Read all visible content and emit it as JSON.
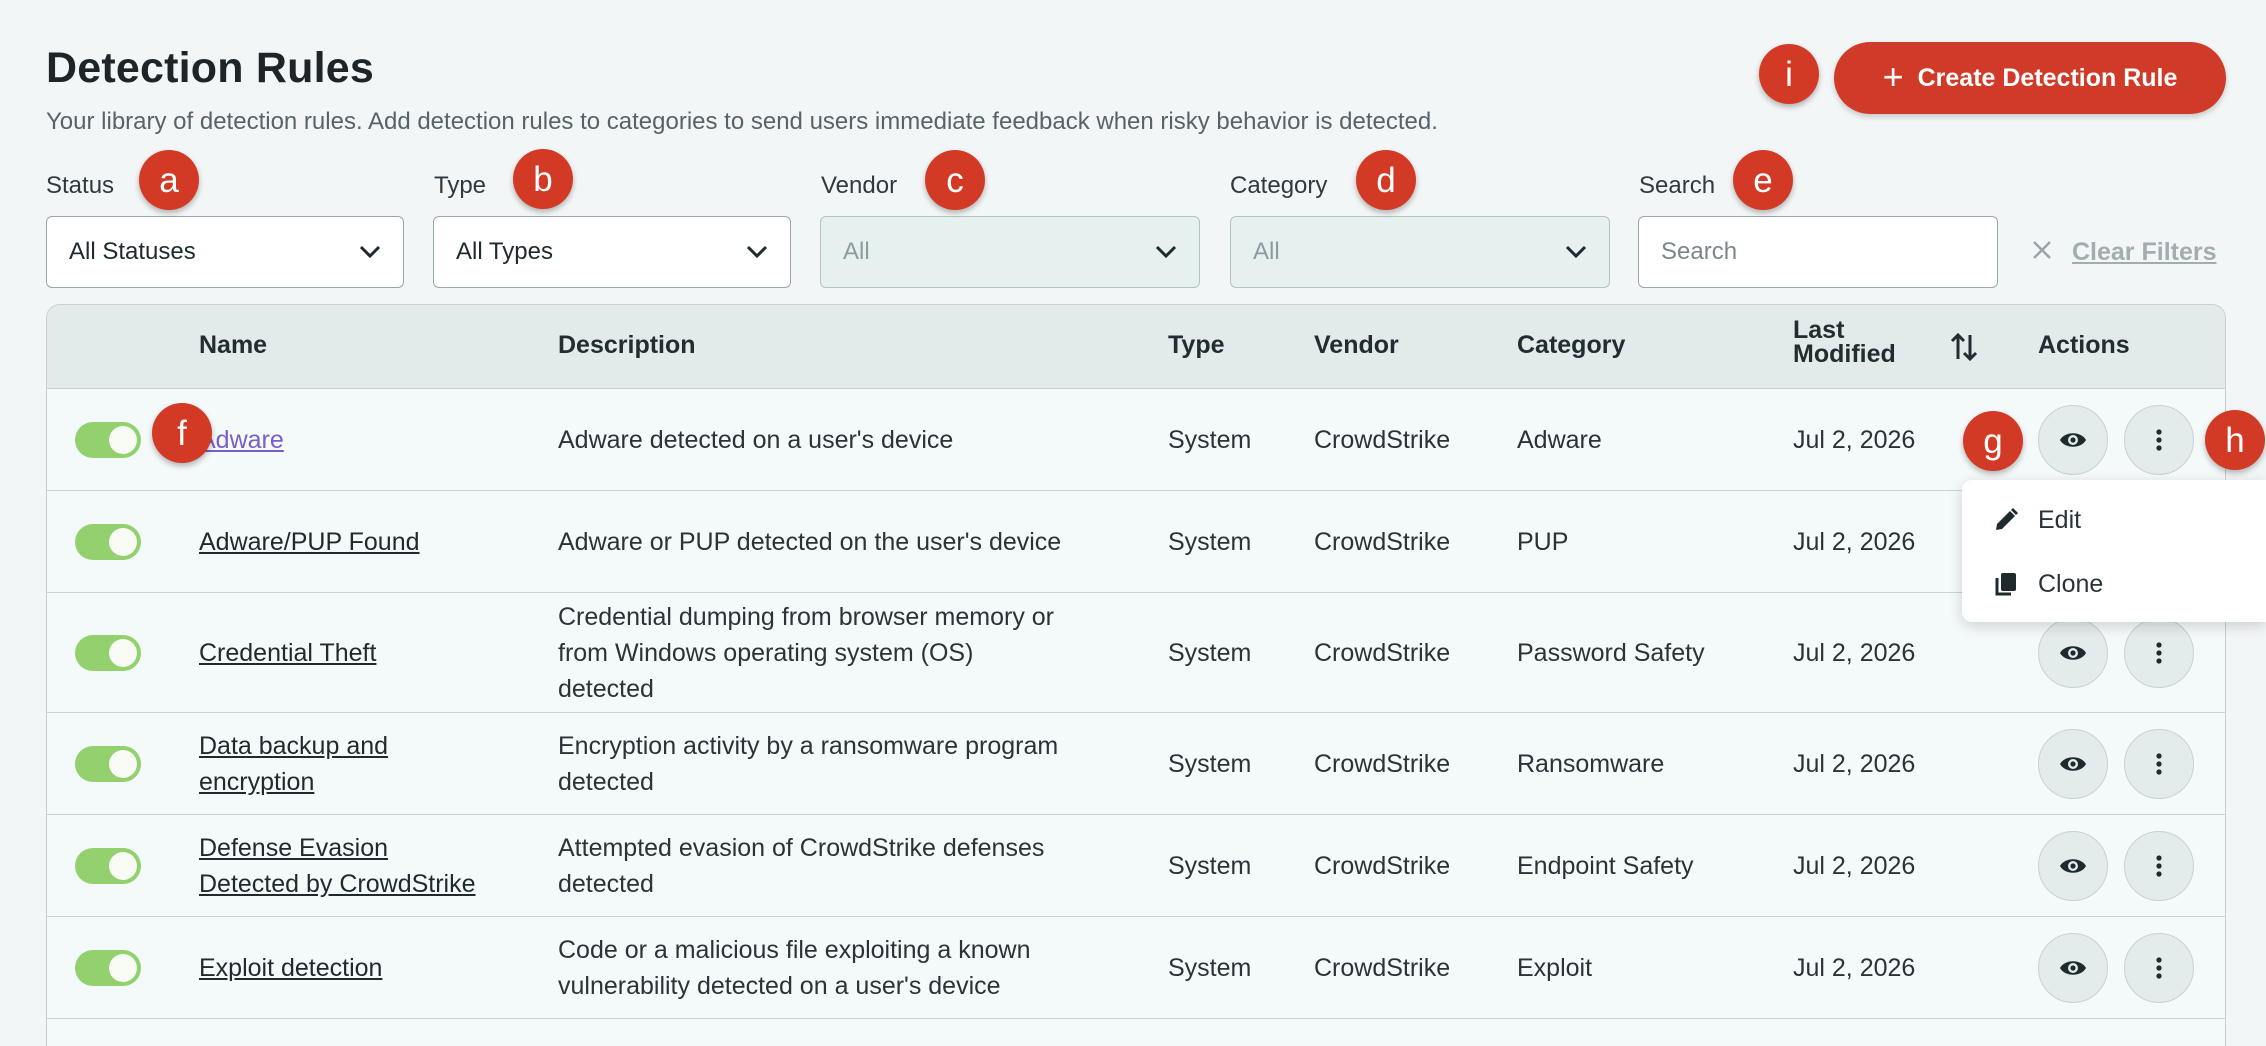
{
  "header": {
    "title": "Detection Rules",
    "subtitle": "Your library of detection rules. Add detection rules to categories to send users immediate feedback when risky behavior is detected.",
    "create_label": "Create Detection Rule"
  },
  "filters": {
    "status": {
      "label": "Status",
      "value": "All Statuses"
    },
    "type": {
      "label": "Type",
      "value": "All Types"
    },
    "vendor": {
      "label": "Vendor",
      "value": "All"
    },
    "category": {
      "label": "Category",
      "value": "All"
    },
    "search": {
      "label": "Search",
      "placeholder": "Search"
    },
    "clear_label": "Clear Filters"
  },
  "badges": [
    "a",
    "b",
    "c",
    "d",
    "e",
    "f",
    "g",
    "h",
    "i"
  ],
  "table": {
    "columns": {
      "name": "Name",
      "description": "Description",
      "type": "Type",
      "vendor": "Vendor",
      "category": "Category",
      "last_modified_1": "Last",
      "last_modified_2": "Modified",
      "actions": "Actions"
    },
    "rows": [
      {
        "name_1": "Adware",
        "name_2": "",
        "desc_1": "Adware detected on a user's device",
        "desc_2": "",
        "desc_3": "",
        "type": "System",
        "vendor": "CrowdStrike",
        "category": "Adware",
        "modified": "Jul 2, 2026",
        "enabled": true
      },
      {
        "name_1": "Adware/PUP Found",
        "name_2": "",
        "desc_1": "Adware or PUP detected on the user's device",
        "desc_2": "",
        "desc_3": "",
        "type": "System",
        "vendor": "CrowdStrike",
        "category": "PUP",
        "modified": "Jul 2, 2026",
        "enabled": true
      },
      {
        "name_1": "Credential Theft",
        "name_2": "",
        "desc_1": "Credential dumping from browser memory or",
        "desc_2": "from Windows operating system (OS)",
        "desc_3": "detected",
        "type": "System",
        "vendor": "CrowdStrike",
        "category": "Password Safety",
        "modified": "Jul 2, 2026",
        "enabled": true
      },
      {
        "name_1": "Data backup and",
        "name_2": "encryption",
        "desc_1": "Encryption activity by a ransomware program",
        "desc_2": "detected",
        "desc_3": "",
        "type": "System",
        "vendor": "CrowdStrike",
        "category": "Ransomware",
        "modified": "Jul 2, 2026",
        "enabled": true
      },
      {
        "name_1": "Defense Evasion",
        "name_2": "Detected by CrowdStrike",
        "desc_1": "Attempted evasion of CrowdStrike defenses",
        "desc_2": "detected",
        "desc_3": "",
        "type": "System",
        "vendor": "CrowdStrike",
        "category": "Endpoint Safety",
        "modified": "Jul 2, 2026",
        "enabled": true
      },
      {
        "name_1": "Exploit detection",
        "name_2": "",
        "desc_1": "Code or a malicious file exploiting a known",
        "desc_2": "vulnerability detected on a user's device",
        "desc_3": "",
        "type": "System",
        "vendor": "CrowdStrike",
        "category": "Exploit",
        "modified": "Jul 2, 2026",
        "enabled": true
      }
    ]
  },
  "menu": {
    "edit_label": "Edit",
    "clone_label": "Clone"
  },
  "icons": {
    "toggle": "toggle-on-icon",
    "view": "eye-icon",
    "more": "kebab-menu-icon",
    "sort": "sort-arrows-icon",
    "edit": "pencil-icon",
    "clone": "copy-icon",
    "clear": "close-icon",
    "dropdown": "chevron-down-icon"
  },
  "colors": {
    "accent": "#cf3b28",
    "toggle_on": "#93d06e",
    "visited_link": "#7a5ec8"
  }
}
